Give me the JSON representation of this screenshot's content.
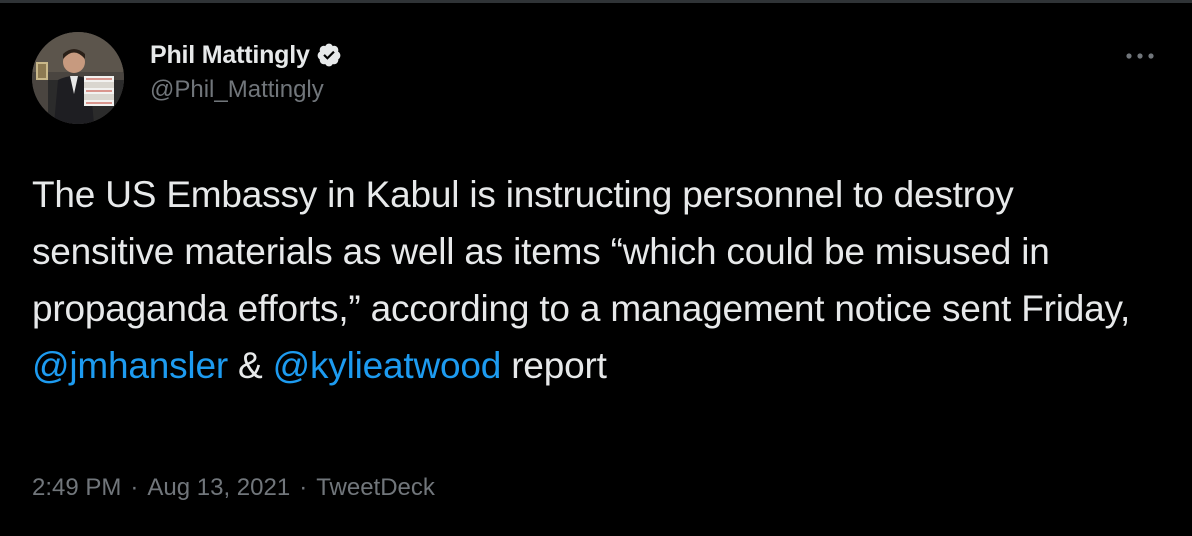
{
  "author": {
    "display_name": "Phil Mattingly",
    "handle": "@Phil_Mattingly",
    "verified": true
  },
  "tweet": {
    "text_part1": "The US Embassy in Kabul is instructing personnel to destroy sensitive materials as well as items “which could be misused in propaganda efforts,” according to a management notice sent Friday, ",
    "mention1": "@jmhansler",
    "text_part2": " & ",
    "mention2": "@kylieatwood",
    "text_part3": " report"
  },
  "meta": {
    "time": "2:49 PM",
    "separator": "·",
    "date": "Aug 13, 2021",
    "source": "TweetDeck"
  },
  "colors": {
    "background": "#000000",
    "text": "#e7e9ea",
    "secondary": "#71767b",
    "link": "#1d9bf0"
  },
  "icons": {
    "verified": "verified-badge-icon",
    "more": "more-options-icon"
  }
}
